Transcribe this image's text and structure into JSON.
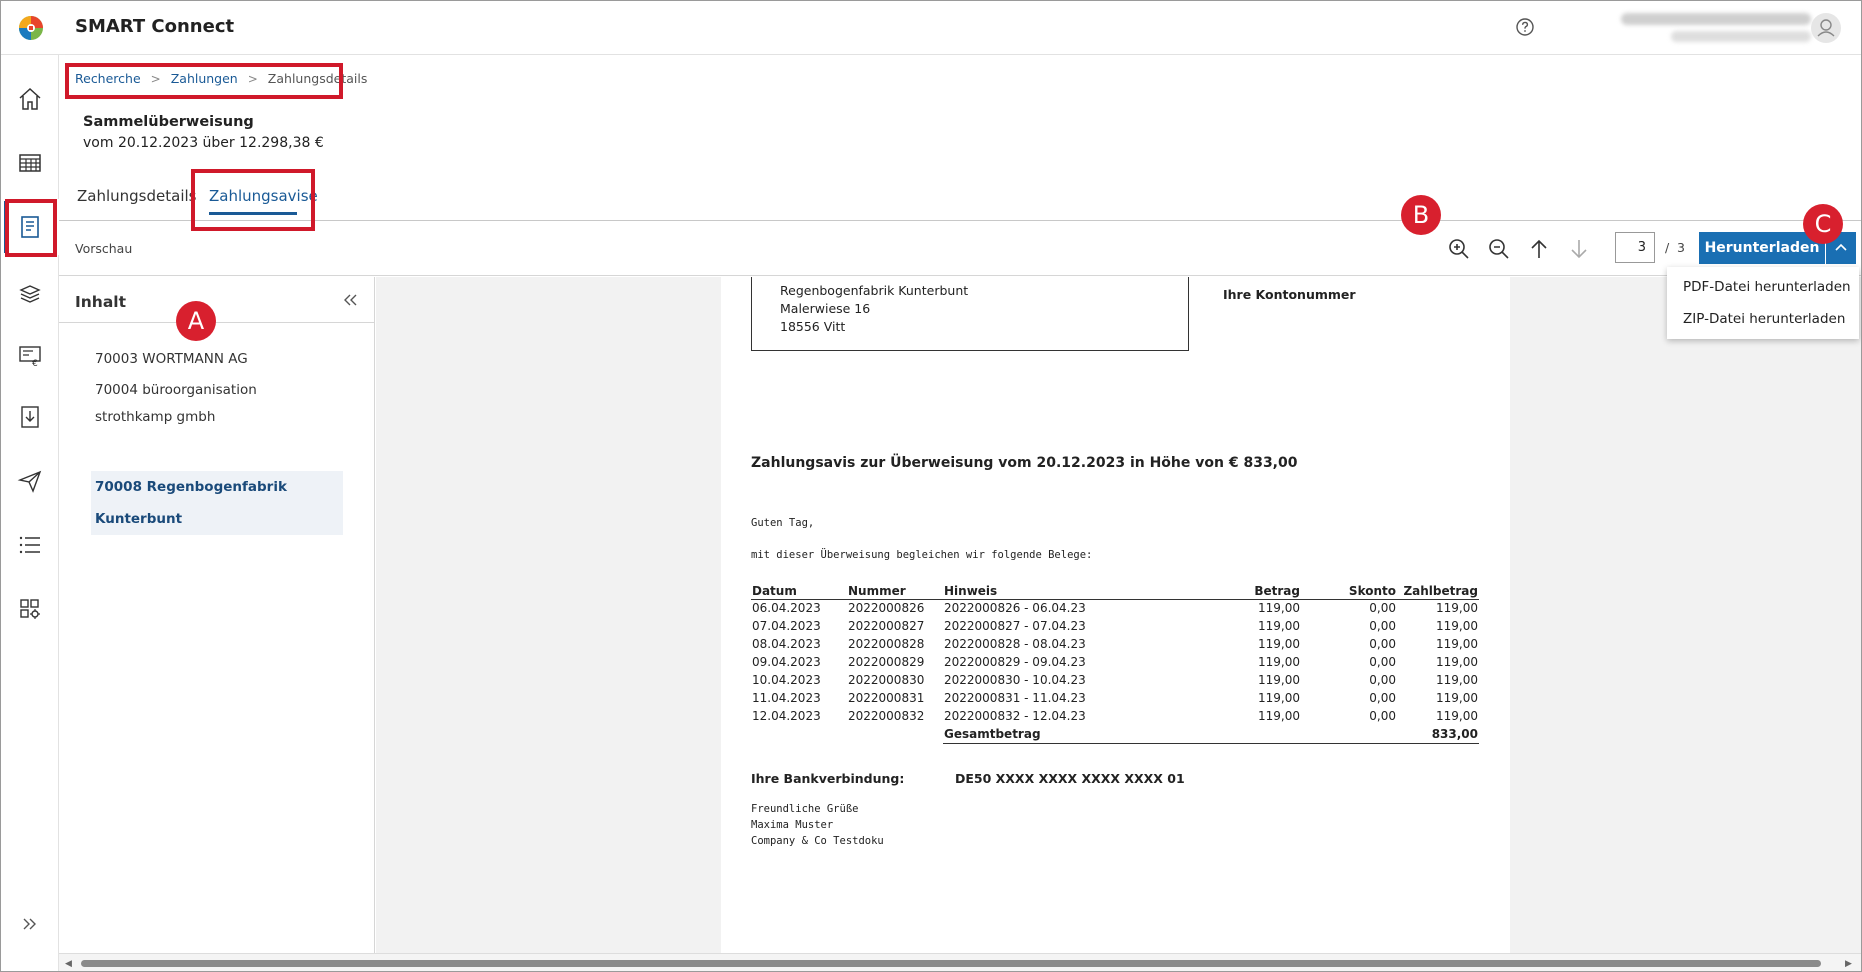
{
  "app": {
    "title": "SMART Connect"
  },
  "breadcrumb": {
    "items": [
      "Recherche",
      "Zahlungen",
      "Zahlungsdetails"
    ],
    "separator": ">"
  },
  "header": {
    "title": "Sammelüberweisung",
    "subtitle": "vom 20.12.2023 über 12.298,38 €"
  },
  "tabs": [
    {
      "label": "Zahlungsdetails",
      "active": false
    },
    {
      "label": "Zahlungsavise",
      "active": true
    }
  ],
  "toolbar": {
    "label": "Vorschau",
    "page_current": "3",
    "page_sep": "/",
    "page_total": "3",
    "download_label": "Herunterladen"
  },
  "markers": {
    "a": "A",
    "b": "B",
    "c": "C"
  },
  "download_menu": [
    "PDF-Datei herunterladen",
    "ZIP-Datei herunterladen"
  ],
  "side_panel": {
    "title": "Inhalt",
    "items": [
      {
        "label": "70003 WORTMANN AG",
        "active": false
      },
      {
        "label": "70004 büroorganisation strothkamp gmbh",
        "active": false
      },
      {
        "label": "70008 Regenbogenfabrik Kunterbunt",
        "active": true
      }
    ]
  },
  "document": {
    "address": [
      "Regenbogenfabrik Kunterbunt",
      "Malerwiese 16",
      "18556 Vitt"
    ],
    "account_label": "Ihre Kontonummer",
    "heading": "Zahlungsavis zur Überweisung vom 20.12.2023 in Höhe von € 833,00",
    "greeting": "Guten Tag,",
    "intro": "mit dieser Überweisung begleichen wir folgende Belege:",
    "table": {
      "headers": [
        "Datum",
        "Nummer",
        "Hinweis",
        "Betrag",
        "Skonto",
        "Zahlbetrag"
      ],
      "rows": [
        [
          "06.04.2023",
          "2022000826",
          "2022000826 - 06.04.23",
          "119,00",
          "0,00",
          "119,00"
        ],
        [
          "07.04.2023",
          "2022000827",
          "2022000827 - 07.04.23",
          "119,00",
          "0,00",
          "119,00"
        ],
        [
          "08.04.2023",
          "2022000828",
          "2022000828 - 08.04.23",
          "119,00",
          "0,00",
          "119,00"
        ],
        [
          "09.04.2023",
          "2022000829",
          "2022000829 - 09.04.23",
          "119,00",
          "0,00",
          "119,00"
        ],
        [
          "10.04.2023",
          "2022000830",
          "2022000830 - 10.04.23",
          "119,00",
          "0,00",
          "119,00"
        ],
        [
          "11.04.2023",
          "2022000831",
          "2022000831 - 11.04.23",
          "119,00",
          "0,00",
          "119,00"
        ],
        [
          "12.04.2023",
          "2022000832",
          "2022000832 - 12.04.23",
          "119,00",
          "0,00",
          "119,00"
        ]
      ],
      "total_label": "Gesamtbetrag",
      "total_value": "833,00"
    },
    "bank_label": "Ihre Bankverbindung:",
    "bank_value": "DE50 XXXX XXXX XXXX XXXX 01",
    "closing": [
      "Freundliche Grüße",
      "Maxima Muster",
      "Company & Co Testdoku"
    ]
  },
  "icons": {
    "logo": "wolters-kluwer-logo-icon",
    "help": "help-icon",
    "avatar": "user-icon",
    "nav": [
      "home-icon",
      "table-icon",
      "document-icon",
      "stack-icon",
      "payment-icon",
      "download-icon",
      "send-icon",
      "list-icon",
      "settings-grid-icon",
      "expand-icon"
    ]
  },
  "colors": {
    "accent": "#1a5a96",
    "button": "#1a6fb3",
    "highlight": "#d0192a"
  }
}
